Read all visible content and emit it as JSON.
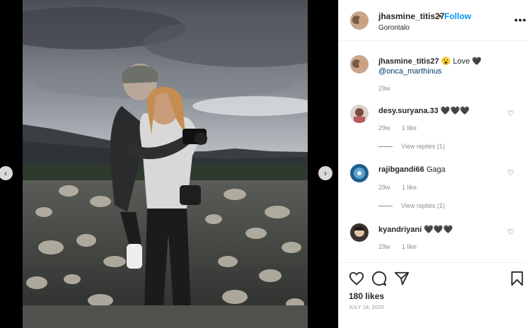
{
  "post": {
    "username": "jhasmine_titis27",
    "follow_label": "Follow",
    "header_separator": "•",
    "location": "Gorontalo",
    "more_label": "•••",
    "caption": {
      "username": "jhasmine_titis27",
      "text": "😮 Love 🖤",
      "mention": "@onca_marthinus",
      "time": "29w"
    },
    "comments": [
      {
        "username": "desy.suryana.33",
        "text": "🖤🖤🖤",
        "time": "29w",
        "likes": "1 like",
        "replies": "View replies (1)"
      },
      {
        "username": "rajibgandi66",
        "text": "Gaga",
        "time": "29w",
        "likes": "1 like",
        "replies": "View replies (1)"
      },
      {
        "username": "kyandriyani",
        "text": "🖤🖤🖤",
        "time": "29w",
        "likes": "1 like"
      }
    ],
    "likes_count": "180 likes",
    "date": "JULY 18, 2020"
  },
  "icons": {
    "prev": "chevron-left-icon",
    "next": "chevron-right-icon",
    "heart": "heart-icon",
    "comment": "comment-icon",
    "share": "share-icon",
    "save": "bookmark-icon"
  },
  "nav": {
    "prev_glyph": "‹",
    "next_glyph": "›"
  },
  "colors": {
    "accent": "#0095f6",
    "muted": "#8e8e8e",
    "text": "#262626"
  }
}
